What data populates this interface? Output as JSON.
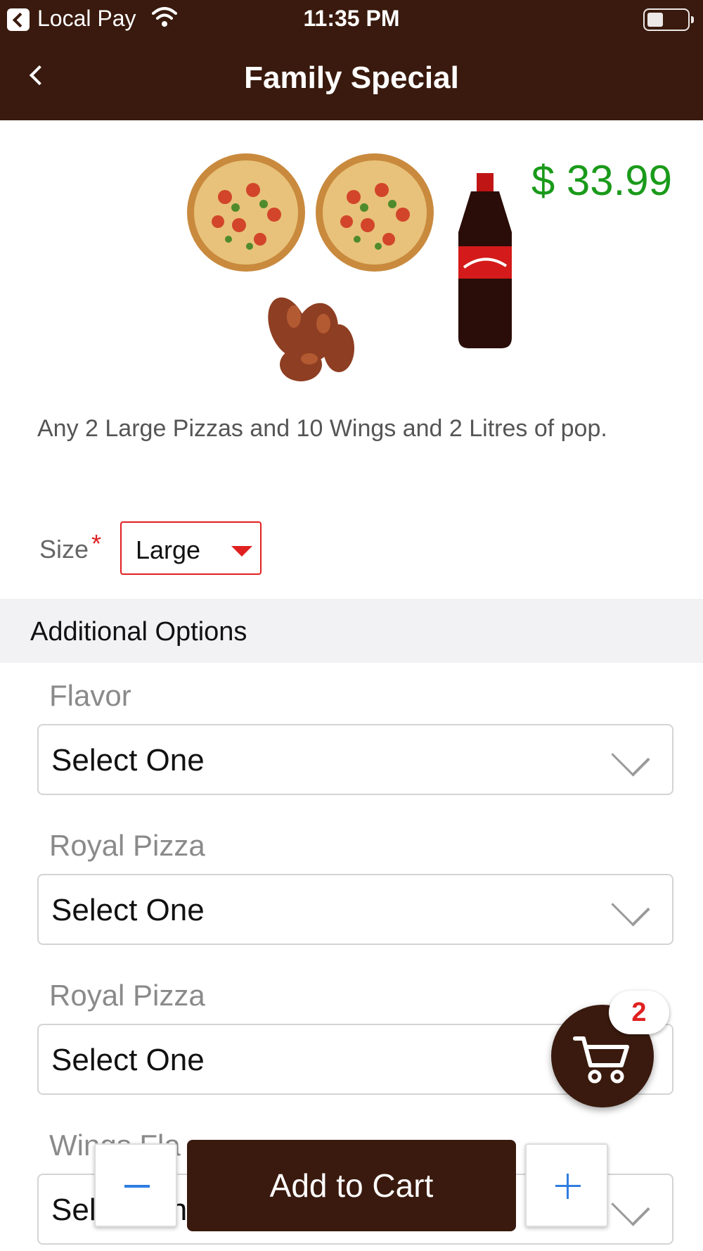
{
  "status_bar": {
    "app_name": "Local Pay",
    "time": "11:35 PM",
    "battery_level": 0.4
  },
  "header": {
    "title": "Family Special"
  },
  "product": {
    "price": "$ 33.99",
    "image_icon": "pizza-wings-pop-image",
    "description": "Any 2 Large Pizzas and 10 Wings and 2 Litres of pop."
  },
  "size": {
    "label": "Size",
    "required_mark": "*",
    "value": "Large"
  },
  "additional_options": {
    "title": "Additional Options",
    "items": [
      {
        "label": "Flavor",
        "value": "Select One"
      },
      {
        "label": "Royal Pizza",
        "value": "Select One"
      },
      {
        "label": "Royal Pizza",
        "value": "Select One"
      },
      {
        "label": "Wings Fla",
        "value": "Select One"
      }
    ]
  },
  "cart": {
    "count": "2"
  },
  "actions": {
    "add_to_cart": "Add to Cart"
  },
  "colors": {
    "brand": "#3a1a0e",
    "price": "#1a9a1a",
    "required": "#e02020",
    "stepper": "#2f7de1"
  }
}
